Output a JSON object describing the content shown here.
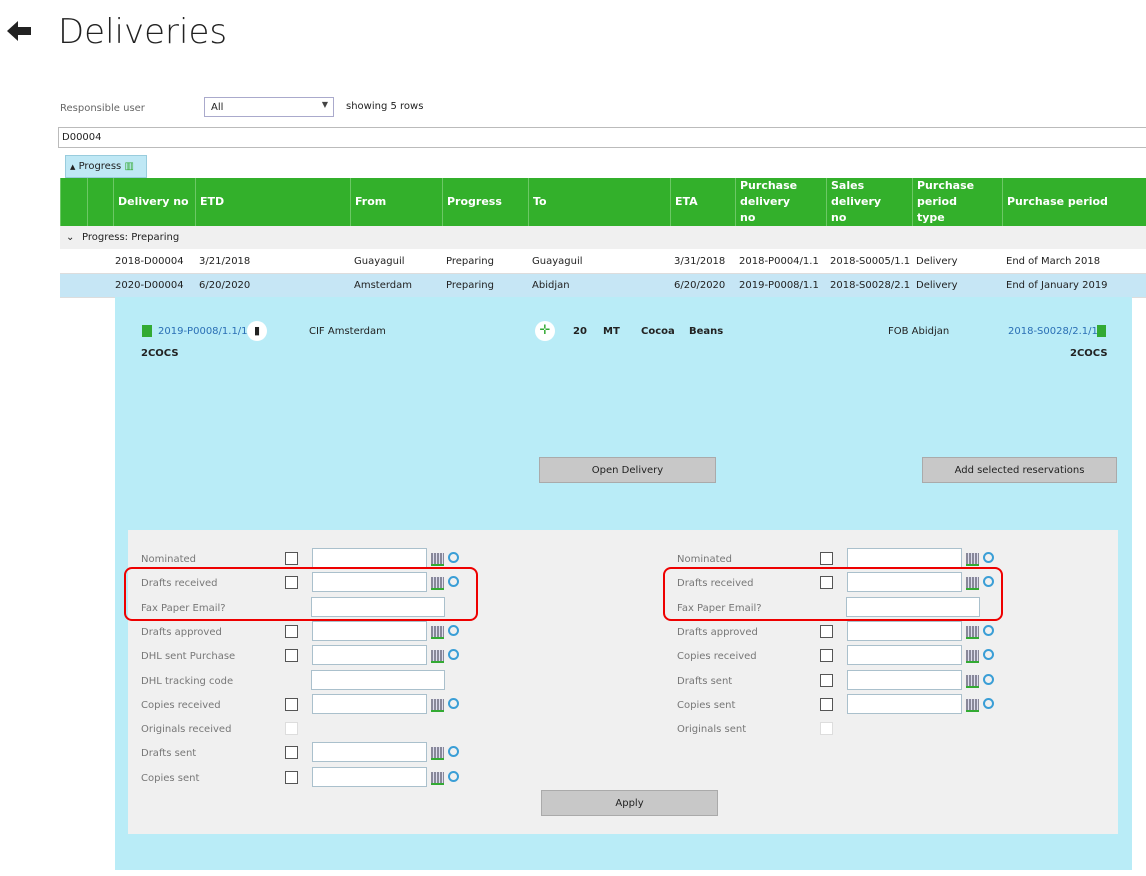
{
  "page": {
    "title": "Deliveries"
  },
  "filter": {
    "responsible_label": "Responsible user",
    "responsible_value": "All",
    "rows_info": "showing 5 rows",
    "search_value": "D00004"
  },
  "grouping": {
    "chip_label": "Progress"
  },
  "table": {
    "columns": [
      "Delivery no",
      "ETD",
      "From",
      "Progress",
      "To",
      "ETA",
      "Purchase delivery no",
      "Sales delivery no",
      "Purchase period type",
      "Purchase period"
    ],
    "group_label": "Progress: Preparing",
    "rows": [
      [
        "2018-D00004",
        "3/21/2018",
        "Guayaguil",
        "Preparing",
        "Guayaguil",
        "3/31/2018",
        "2018-P0004/1.1",
        "2018-S0005/1.1",
        "Delivery",
        "End of March 2018"
      ],
      [
        "2020-D00004",
        "6/20/2020",
        "Amsterdam",
        "Preparing",
        "Abidjan",
        "6/20/2020",
        "2019-P0008/1.1",
        "2018-S0028/2.1",
        "Delivery",
        "End of January 2019"
      ]
    ],
    "selected_row": 1
  },
  "detail": {
    "purchase_link": "2019-P0008/1.1/1",
    "purchase_code": "2COCS",
    "purchase_terms": "CIF Amsterdam",
    "quantity": "20",
    "unit": "MT",
    "product1": "Cocoa",
    "product2": "Beans",
    "sales_terms": "FOB Abidjan",
    "sales_link": "2018-S0028/2.1/1",
    "sales_code": "2COCS",
    "open_button": "Open Delivery",
    "add_button": "Add selected reservations",
    "apply_button": "Apply"
  },
  "form_left": [
    {
      "label": "Nominated",
      "type": "date"
    },
    {
      "label": "Drafts received",
      "type": "date"
    },
    {
      "label": "Fax Paper Email?",
      "type": "text"
    },
    {
      "label": "Drafts approved",
      "type": "date"
    },
    {
      "label": "DHL sent Purchase",
      "type": "date"
    },
    {
      "label": "DHL tracking code",
      "type": "text"
    },
    {
      "label": "Copies received",
      "type": "date"
    },
    {
      "label": "Originals received",
      "type": "disabled"
    },
    {
      "label": "Drafts sent",
      "type": "date"
    },
    {
      "label": "Copies sent",
      "type": "date"
    }
  ],
  "form_right": [
    {
      "label": "Nominated",
      "type": "date"
    },
    {
      "label": "Drafts received",
      "type": "date"
    },
    {
      "label": "Fax Paper Email?",
      "type": "text"
    },
    {
      "label": "Drafts approved",
      "type": "date"
    },
    {
      "label": "Copies received",
      "type": "date"
    },
    {
      "label": "Drafts sent",
      "type": "date"
    },
    {
      "label": "Copies sent",
      "type": "date"
    },
    {
      "label": "Originals sent",
      "type": "disabled"
    }
  ],
  "colors": {
    "header_green": "#33b02b",
    "panel_blue": "#b9ecf7",
    "selected_row": "#c6e6f5",
    "highlight_red": "#e00000"
  }
}
